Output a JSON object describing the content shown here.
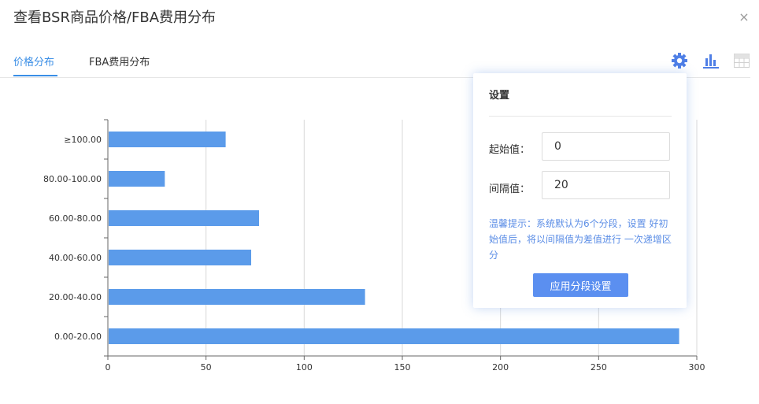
{
  "modal": {
    "title": "查看BSR商品价格/FBA费用分布",
    "close_glyph": "×"
  },
  "tabs": [
    {
      "label": "价格分布",
      "active": true
    },
    {
      "label": "FBA费用分布",
      "active": false
    }
  ],
  "toolbar": {
    "icons": [
      "gear-icon",
      "bar-chart-icon",
      "table-icon"
    ],
    "accent": "#4f7fe6"
  },
  "chart_data": {
    "type": "bar",
    "orientation": "horizontal",
    "categories": [
      "0.00-20.00",
      "20.00-40.00",
      "40.00-60.00",
      "60.00-80.00",
      "80.00-100.00",
      "≥100.00"
    ],
    "values": [
      291,
      131,
      73,
      77,
      29,
      60
    ],
    "xlim": [
      0,
      300
    ],
    "xticks": [
      0,
      50,
      100,
      150,
      200,
      250,
      300
    ],
    "grid": true,
    "bar_color": "#5b9bea"
  },
  "settings": {
    "title": "设置",
    "start_label": "起始值：",
    "start_value": "0",
    "interval_label": "间隔值：",
    "interval_value": "20",
    "tip": "温馨提示：系统默认为6个分段，设置 好初始值后，将以间隔值为差值进行 一次递增区分",
    "apply_label": "应用分段设置"
  }
}
